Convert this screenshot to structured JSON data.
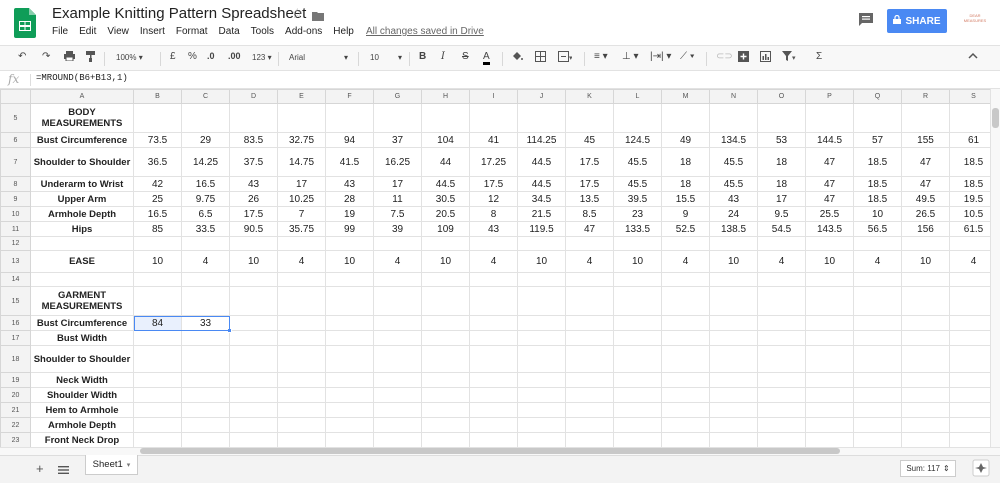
{
  "doc": {
    "title": "Example Knitting Pattern Spreadsheet",
    "saved_status": "All changes saved in Drive",
    "share_label": "SHARE",
    "account_text": "DEAR MEASURES"
  },
  "menu": [
    "File",
    "Edit",
    "View",
    "Insert",
    "Format",
    "Data",
    "Tools",
    "Add-ons",
    "Help"
  ],
  "toolbar": {
    "zoom": "100%",
    "currency": "£",
    "percent": "%",
    "dec_less": ".0",
    "dec_more": ".00",
    "format_more": "123",
    "font": "Arial",
    "font_size": "10",
    "bold": "B",
    "italic": "I",
    "strike": "S",
    "text_color": "A",
    "sigma": "Σ"
  },
  "formula": {
    "fx": "fx",
    "text": "=MROUND(B6+B13,1)"
  },
  "grid": {
    "columns": [
      "A",
      "B",
      "C",
      "D",
      "E",
      "F",
      "G",
      "H",
      "I",
      "J",
      "K",
      "L",
      "M",
      "N",
      "O",
      "P",
      "Q",
      "R",
      "S"
    ],
    "rows": [
      {
        "num": "5",
        "label": "BODY MEASUREMENTS",
        "cells": []
      },
      {
        "num": "6",
        "label": "Bust Circumference",
        "cells": [
          "73.5",
          "29",
          "83.5",
          "32.75",
          "94",
          "37",
          "104",
          "41",
          "114.25",
          "45",
          "124.5",
          "49",
          "134.5",
          "53",
          "144.5",
          "57",
          "155",
          "61"
        ]
      },
      {
        "num": "7",
        "label": "Shoulder to Shoulder",
        "cells": [
          "36.5",
          "14.25",
          "37.5",
          "14.75",
          "41.5",
          "16.25",
          "44",
          "17.25",
          "44.5",
          "17.5",
          "45.5",
          "18",
          "45.5",
          "18",
          "47",
          "18.5",
          "47",
          "18.5"
        ]
      },
      {
        "num": "8",
        "label": "Underarm to Wrist",
        "cells": [
          "42",
          "16.5",
          "43",
          "17",
          "43",
          "17",
          "44.5",
          "17.5",
          "44.5",
          "17.5",
          "45.5",
          "18",
          "45.5",
          "18",
          "47",
          "18.5",
          "47",
          "18.5"
        ]
      },
      {
        "num": "9",
        "label": "Upper Arm",
        "cells": [
          "25",
          "9.75",
          "26",
          "10.25",
          "28",
          "11",
          "30.5",
          "12",
          "34.5",
          "13.5",
          "39.5",
          "15.5",
          "43",
          "17",
          "47",
          "18.5",
          "49.5",
          "19.5"
        ]
      },
      {
        "num": "10",
        "label": "Armhole Depth",
        "cells": [
          "16.5",
          "6.5",
          "17.5",
          "7",
          "19",
          "7.5",
          "20.5",
          "8",
          "21.5",
          "8.5",
          "23",
          "9",
          "24",
          "9.5",
          "25.5",
          "10",
          "26.5",
          "10.5"
        ]
      },
      {
        "num": "11",
        "label": "Hips",
        "cells": [
          "85",
          "33.5",
          "90.5",
          "35.75",
          "99",
          "39",
          "109",
          "43",
          "119.5",
          "47",
          "133.5",
          "52.5",
          "138.5",
          "54.5",
          "143.5",
          "56.5",
          "156",
          "61.5"
        ]
      },
      {
        "num": "12",
        "label": "",
        "cells": []
      },
      {
        "num": "13",
        "label": "EASE",
        "cells": [
          "10",
          "4",
          "10",
          "4",
          "10",
          "4",
          "10",
          "4",
          "10",
          "4",
          "10",
          "4",
          "10",
          "4",
          "10",
          "4",
          "10",
          "4"
        ]
      },
      {
        "num": "14",
        "label": "",
        "cells": []
      },
      {
        "num": "15",
        "label": "GARMENT MEASUREMENTS",
        "cells": []
      },
      {
        "num": "16",
        "label": "Bust Circumference",
        "cells": [
          "84",
          "33"
        ]
      },
      {
        "num": "17",
        "label": "Bust Width",
        "cells": []
      },
      {
        "num": "18",
        "label": "Shoulder to Shoulder",
        "cells": []
      },
      {
        "num": "19",
        "label": "Neck Width",
        "cells": []
      },
      {
        "num": "20",
        "label": "Shoulder Width",
        "cells": []
      },
      {
        "num": "21",
        "label": "Hem to Armhole",
        "cells": []
      },
      {
        "num": "22",
        "label": "Armhole Depth",
        "cells": []
      },
      {
        "num": "23",
        "label": "Front Neck Drop",
        "cells": []
      }
    ]
  },
  "sheets": {
    "active": "Sheet1",
    "sum": "Sum: 117"
  },
  "colors": {
    "accent": "#4a89f3",
    "logo": "#0f9d58"
  }
}
